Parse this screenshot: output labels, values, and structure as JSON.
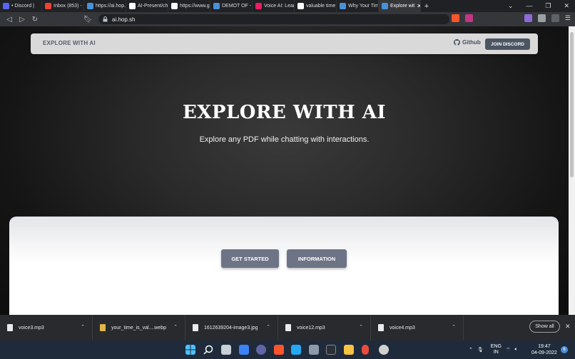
{
  "browser": {
    "tabs": [
      {
        "label": "• Discord |",
        "color": "#5865f2"
      },
      {
        "label": "Inbox (853) - ",
        "color": "#ea4335"
      },
      {
        "label": "https://ai.hop.",
        "color": "#4a90d9"
      },
      {
        "label": "AI-Present/cha",
        "color": "#ffffff"
      },
      {
        "label": "https://www.go",
        "color": "#ffffff"
      },
      {
        "label": "DEMOT OF - Vi",
        "color": "#4a90d9"
      },
      {
        "label": "Voice AI: Learn",
        "color": "#e91e63"
      },
      {
        "label": "valuable time -",
        "color": "#ffffff"
      },
      {
        "label": "Why Your Time",
        "color": "#4a90d9"
      },
      {
        "label": "Explore wit",
        "color": "#4a90d9"
      }
    ],
    "url": "ai.hop.sh",
    "brave_badge": "1",
    "alert_badge": "1"
  },
  "site": {
    "brand": "EXPLORE WITH AI",
    "github_label": "Github",
    "discord_label": "JOIN DISCORD",
    "hero_title": "EXPLORE WITH AI",
    "hero_subtitle": "Explore any PDF while chatting with interactions.",
    "get_started": "GET STARTED",
    "information": "INFORMATION"
  },
  "downloads": {
    "items": [
      "voice3.mp3",
      "your_time_is_val....webp",
      "1612639204-image3.jpg",
      "voice12.mp3",
      "voice4.mp3"
    ],
    "show_all": "Show all"
  },
  "taskbar": {
    "lang": "ENG",
    "region": "IN",
    "time": "19:47",
    "date": "04-09-2022",
    "notif_count": "6"
  }
}
